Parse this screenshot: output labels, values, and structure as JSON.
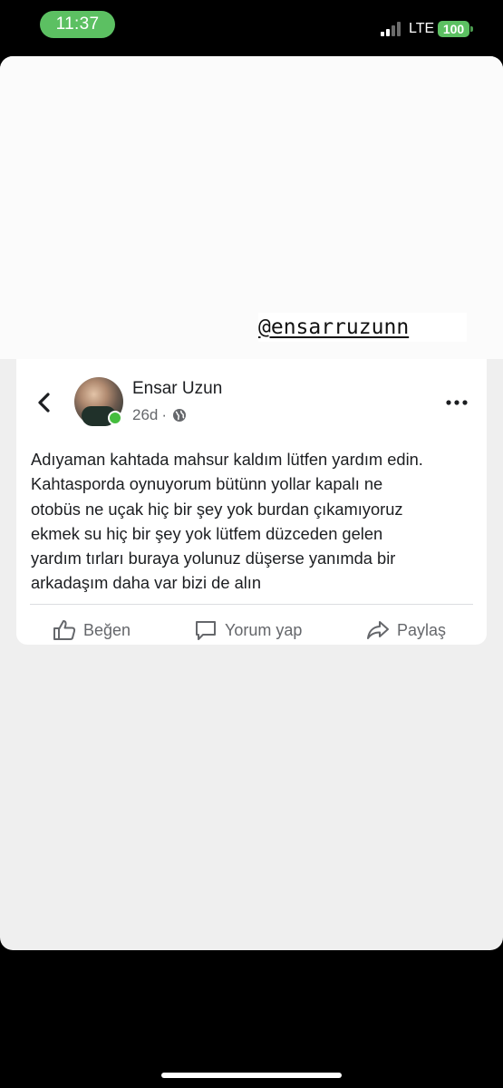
{
  "status_bar": {
    "time": "11:37",
    "network": "LTE",
    "battery": "100",
    "accent_color": "#5cc062"
  },
  "story": {
    "mention": "@ensarruzunn"
  },
  "post": {
    "author": "Ensar Uzun",
    "age": "26d",
    "separator": "·",
    "text": "Adıyaman kahtada mahsur kaldım lütfen yardım edin.\nKahtasporda oynuyorum bütünn yollar kapalı ne\notobüs ne uçak hiç bir şey yok burdan çıkamıyoruz\nekmek su hiç bir şey yok lütfem düzceden gelen\nyardım tırları buraya yolunuz düşerse yanımda bir\narkadaşım daha var bizi de alın",
    "online_color": "#45bd3e",
    "icons": {
      "back": "chevron-left-icon",
      "audience": "globe-icon",
      "more": "more-horizontal-icon"
    },
    "actions": {
      "like": "Beğen",
      "comment": "Yorum yap",
      "share": "Paylaş"
    }
  }
}
